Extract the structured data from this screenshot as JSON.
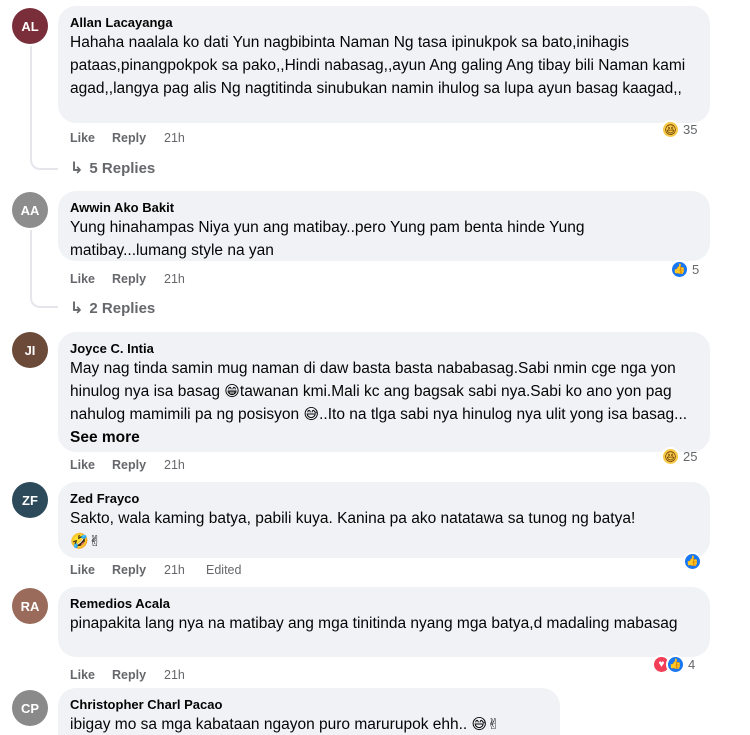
{
  "comments": [
    {
      "author": "Allan Lacayanga",
      "text": "Hahaha naalala ko dati Yun nagbibinta Naman Ng tasa ipinukpok sa bato,inihagis pataas,pinangpokpok sa pako,,Hindi nabasag,,ayun Ang galing Ang tibay bili Naman kami agad,,langya pag alis Ng nagtitinda sinubukan namin ihulog sa lupa ayun basag kaagad,,",
      "like": "Like",
      "reply": "Reply",
      "time": "21h",
      "reaction_count": "35",
      "replies": "5 Replies",
      "avatar_color": "#7a2e3a"
    },
    {
      "author": "Awwin Ako Bakit",
      "text": "Yung hinahampas Niya yun ang matibay..pero Yung pam benta hinde Yung matibay...lumang style na yan",
      "like": "Like",
      "reply": "Reply",
      "time": "21h",
      "reaction_count": "5",
      "replies": "2 Replies",
      "avatar_color": "#8d8d8d"
    },
    {
      "author": "Joyce C. Intia",
      "text_a": "May nag tinda samin mug naman di daw basta basta nababasag.Sabi nmin cge nga yon hinulog nya isa basag ",
      "emoji_a": "😁",
      "text_b": "tawanan kmi.Mali kc ang bagsak sabi nya.Sabi ko ano yon pag nahulog mamimili pa ng posisyon ",
      "emoji_b": "😅",
      "text_c": "..Ito na tlga sabi nya hinulog nya ulit yong isa basag... ",
      "see_more": "See more",
      "like": "Like",
      "reply": "Reply",
      "time": "21h",
      "reaction_count": "25",
      "avatar_color": "#6b4a3a"
    },
    {
      "author": "Zed Frayco",
      "text": "Sakto, wala kaming batya, pabili kuya. Kanina pa ako natatawa sa tunog ng batya!",
      "emojis": "🤣✌",
      "like": "Like",
      "reply": "Reply",
      "time": "21h",
      "edited": "Edited",
      "avatar_color": "#2c4a5a"
    },
    {
      "author": "Remedios Acala",
      "text": "pinapakita lang nya na matibay ang mga tinitinda nyang mga batya,d madaling mabasag",
      "like": "Like",
      "reply": "Reply",
      "time": "21h",
      "reaction_count": "4",
      "avatar_color": "#9a6a5a"
    },
    {
      "author": "Christopher Charl Pacao",
      "text": "ibigay mo sa mga kabataan ngayon puro marurupok ehh.. ",
      "emojis": "😅✌",
      "avatar_color": "#8a8a8a"
    }
  ],
  "icons": {
    "haha": "😆",
    "like": "👍",
    "love": "♥",
    "reply_arrow": "↳"
  }
}
